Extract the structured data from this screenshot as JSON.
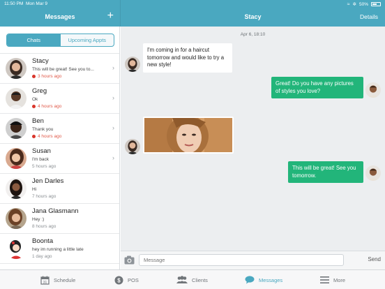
{
  "status_bar": {
    "time": "11:50 PM",
    "date": "Mon Mar 9",
    "battery": "50%"
  },
  "left_header": {
    "title": "Messages",
    "add_icon": "plus-icon"
  },
  "right_header": {
    "title": "Stacy",
    "details_label": "Details"
  },
  "segments": {
    "chats": "Chats",
    "upcoming": "Upcoming Appts",
    "active": "chats"
  },
  "conversations": [
    {
      "name": "Stacy",
      "preview": "This will be great! See you to...",
      "time": "3 hours ago",
      "unread": true,
      "chevron": true
    },
    {
      "name": "Greg",
      "preview": "Ok",
      "time": "4 hours ago",
      "unread": true,
      "chevron": true
    },
    {
      "name": "Ben",
      "preview": "Thank you",
      "time": "4 hours ago",
      "unread": true,
      "chevron": true
    },
    {
      "name": "Susan",
      "preview": "I'm back",
      "time": "5 hours ago",
      "unread": false,
      "chevron": true
    },
    {
      "name": "Jen Darles",
      "preview": "Hi",
      "time": "7 hours ago",
      "unread": false,
      "chevron": false
    },
    {
      "name": "Jana Glasmann",
      "preview": "Hey :)",
      "time": "8 hours ago",
      "unread": false,
      "chevron": false
    },
    {
      "name": "Boonta",
      "preview": "hey im running a little late",
      "time": "1 day ago",
      "unread": false,
      "chevron": false
    }
  ],
  "chat": {
    "date_stamp": "Apr 6, 18:10",
    "messages": [
      {
        "direction": "in",
        "text": "I'm coming in for a haircut tomorrow and would like to try a new style!"
      },
      {
        "direction": "out",
        "text": "Great! Do you have any pictures of styles you love?"
      },
      {
        "direction": "in",
        "type": "image",
        "alt": "woman-portrait-photo"
      },
      {
        "direction": "out",
        "text": "This will be great! See you tomorrow."
      }
    ]
  },
  "composer": {
    "placeholder": "Message",
    "send_label": "Send"
  },
  "tabs": [
    {
      "label": "Schedule",
      "icon": "calendar-icon",
      "active": false
    },
    {
      "label": "POS",
      "icon": "dollar-icon",
      "active": false
    },
    {
      "label": "Clients",
      "icon": "people-icon",
      "active": false
    },
    {
      "label": "Messages",
      "icon": "chat-bubble-icon",
      "active": true
    },
    {
      "label": "More",
      "icon": "menu-icon",
      "active": false
    }
  ],
  "colors": {
    "teal": "#4aa8c0",
    "green": "#22b57a",
    "unread_red": "#d9352b"
  }
}
